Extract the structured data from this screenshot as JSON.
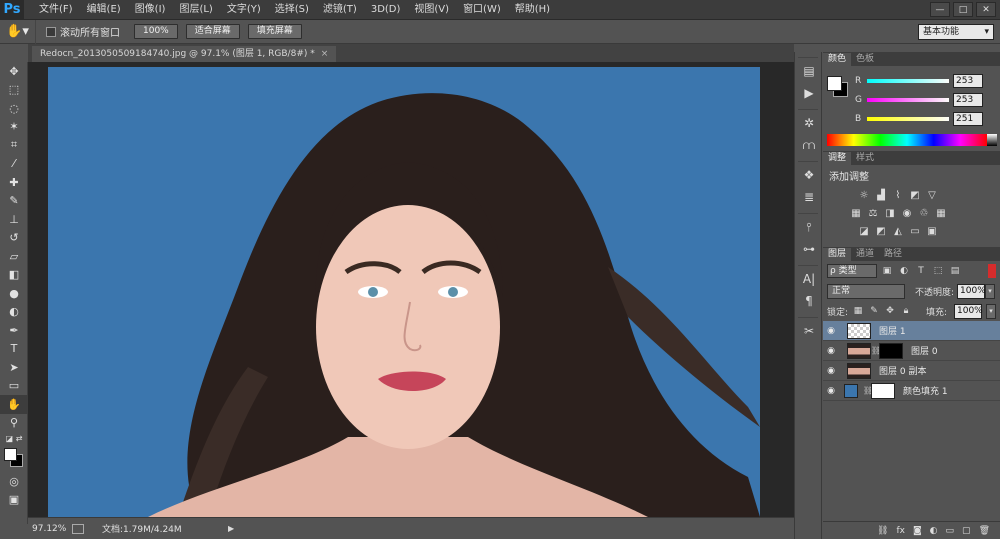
{
  "app": {
    "logo": "Ps"
  },
  "menu": [
    "文件(F)",
    "编辑(E)",
    "图像(I)",
    "图层(L)",
    "文字(Y)",
    "选择(S)",
    "滤镜(T)",
    "3D(D)",
    "视图(V)",
    "窗口(W)",
    "帮助(H)"
  ],
  "window_controls": [
    "—",
    "□",
    "✕"
  ],
  "options_bar": {
    "scroll_all_label": "滚动所有窗口",
    "zoom_100": "100%",
    "fit_screen": "适合屏幕",
    "fill_screen": "填充屏幕",
    "workspace": "基本功能"
  },
  "document": {
    "tab_title": "Redocn_2013050509184740.jpg @ 97.1% (图层 1, RGB/8#) *",
    "close": "×",
    "canvas_color": "#3b76ae"
  },
  "status": {
    "zoom": "97.12%",
    "doc_info": "文档:1.79M/4.24M"
  },
  "color_panel": {
    "tabs": [
      "颜色",
      "色板"
    ],
    "channels": [
      {
        "label": "R",
        "value": "253"
      },
      {
        "label": "G",
        "value": "253"
      },
      {
        "label": "B",
        "value": "251"
      }
    ]
  },
  "adjustments_panel": {
    "tabs": [
      "调整",
      "样式"
    ],
    "title": "添加调整"
  },
  "layers_panel": {
    "tabs": [
      "图层",
      "通道",
      "路径"
    ],
    "kind": "ρ 类型",
    "blend_mode": "正常",
    "opacity_label": "不透明度:",
    "opacity": "100%",
    "lock_label": "锁定:",
    "fill_label": "填充:",
    "fill": "100%",
    "layers": [
      {
        "name": "图层 1",
        "selected": true
      },
      {
        "name": "图层 0",
        "selected": false
      },
      {
        "name": "图层 0 副本",
        "selected": false
      },
      {
        "name": "颜色填充 1",
        "selected": false
      }
    ]
  },
  "colors": {
    "accent_blue": "#31a8ff",
    "selection": "#67809c",
    "fg": "#ffffff",
    "bg": "#000000"
  }
}
